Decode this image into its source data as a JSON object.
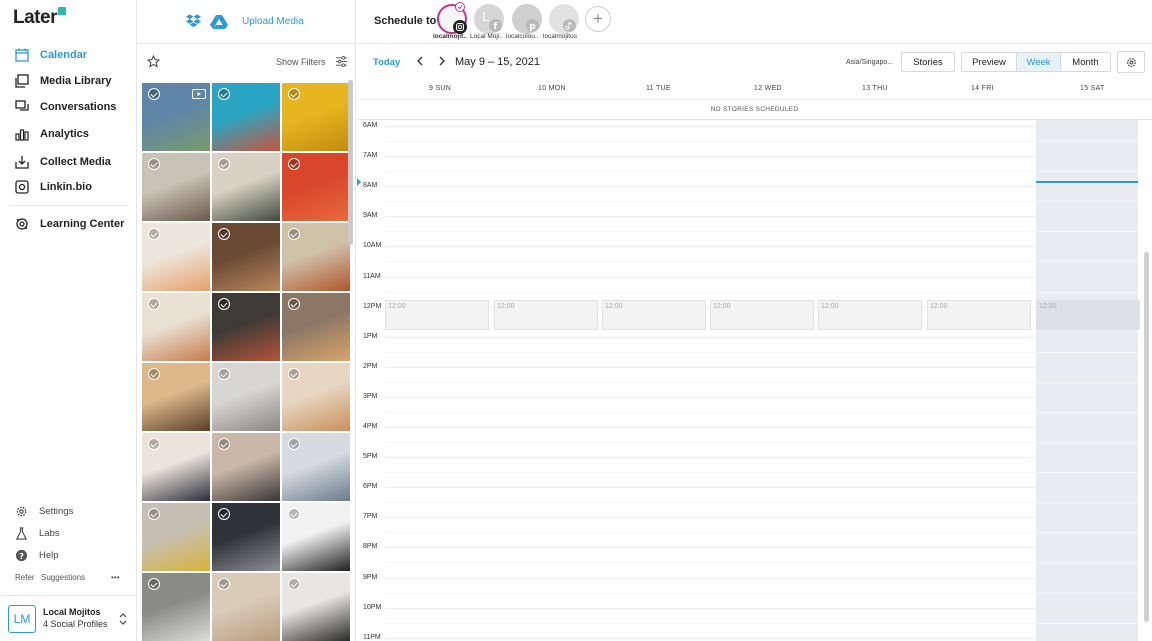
{
  "app": {
    "logo_text": "Later"
  },
  "sidebar": {
    "items": [
      {
        "label": "Calendar",
        "icon": "calendar-icon",
        "active": true
      },
      {
        "label": "Media Library",
        "icon": "media-library-icon"
      },
      {
        "label": "Conversations",
        "icon": "conversations-icon"
      },
      {
        "label": "Analytics",
        "icon": "analytics-icon"
      },
      {
        "label": "Collect Media",
        "icon": "collect-media-icon"
      },
      {
        "label": "Linkin.bio",
        "icon": "linkinbio-icon"
      },
      {
        "label": "Learning Center",
        "icon": "learning-center-icon"
      }
    ],
    "footer": [
      {
        "label": "Settings",
        "icon": "settings-gear-icon"
      },
      {
        "label": "Labs",
        "icon": "labs-flask-icon"
      },
      {
        "label": "Help",
        "icon": "help-icon"
      }
    ],
    "refer": "Refer",
    "suggestions": "Suggestions",
    "more": "•••",
    "profile": {
      "initials": "LM",
      "name": "Local Mojitos",
      "sub": "4 Social Profiles"
    }
  },
  "media": {
    "upload_label": "Upload Media",
    "show_filters": "Show Filters",
    "thumbnails": [
      {
        "c1": "#5f86a8",
        "c2": "#7a9a6a",
        "video": true
      },
      {
        "c1": "#2aa6c4",
        "c2": "#c4553c"
      },
      {
        "c1": "#e6b620",
        "c2": "#c28a10"
      },
      {
        "c1": "#c9c2b6",
        "c2": "#6b5a4a"
      },
      {
        "c1": "#d8d2c4",
        "c2": "#3f4a3c"
      },
      {
        "c1": "#d9462a",
        "c2": "#e86a3c"
      },
      {
        "c1": "#ece6dc",
        "c2": "#e7a06a"
      },
      {
        "c1": "#6a4a34",
        "c2": "#b9875c"
      },
      {
        "c1": "#cfc0a8",
        "c2": "#b0562c"
      },
      {
        "c1": "#e9e1d4",
        "c2": "#c77b4c"
      },
      {
        "c1": "#3e3a36",
        "c2": "#b5543a"
      },
      {
        "c1": "#8c7766",
        "c2": "#d9a46a"
      },
      {
        "c1": "#ddb88a",
        "c2": "#5a3e28"
      },
      {
        "c1": "#d8d6d2",
        "c2": "#8a8680"
      },
      {
        "c1": "#e7d6c2",
        "c2": "#c98f5c"
      },
      {
        "c1": "#ece4da",
        "c2": "#2b2f3c"
      },
      {
        "c1": "#c9b8a8",
        "c2": "#3a3634"
      },
      {
        "c1": "#d6dbe0",
        "c2": "#6a7c8c"
      },
      {
        "c1": "#c6c0b4",
        "c2": "#d9b23a"
      },
      {
        "c1": "#2f3236",
        "c2": "#8b8f93"
      },
      {
        "c1": "#f1f1f1",
        "c2": "#1f1f1f"
      },
      {
        "c1": "#8a8a88",
        "c2": "#dcdcd8"
      },
      {
        "c1": "#d9cbb8",
        "c2": "#b99c7c"
      },
      {
        "c1": "#e8e6e2",
        "c2": "#2a2a2a"
      }
    ]
  },
  "calendar": {
    "schedule_to": "Schedule to",
    "profiles": [
      {
        "name": "localmojit..",
        "network": "instagram"
      },
      {
        "name": "Local Moji..",
        "network": "facebook",
        "initial": "L"
      },
      {
        "name": "localcolou..",
        "network": "pinterest"
      },
      {
        "name": "localmojitos",
        "network": "tiktok"
      }
    ],
    "add_profile": "+",
    "today": "Today",
    "range": "May 9 – 15, 2021",
    "timezone": "Asia/Singapo...",
    "stories_btn": "Stories",
    "preview_btn": "Preview",
    "week_btn": "Week",
    "month_btn": "Month",
    "days": [
      "9 SUN",
      "10 MON",
      "11 TUE",
      "12 WED",
      "13 THU",
      "14 FRI",
      "15 SAT"
    ],
    "no_stories": "NO STORIES SCHEDULED",
    "hours": [
      "6AM",
      "7AM",
      "8AM",
      "9AM",
      "10AM",
      "11AM",
      "12PM",
      "1PM",
      "2PM",
      "3PM",
      "4PM",
      "5PM",
      "6PM",
      "7PM",
      "8PM",
      "9PM",
      "10PM",
      "11PM"
    ],
    "noon_slot_label": "12:00",
    "colors": {
      "accent": "#2a9bd4",
      "instagram_ring": "#c13584"
    }
  }
}
